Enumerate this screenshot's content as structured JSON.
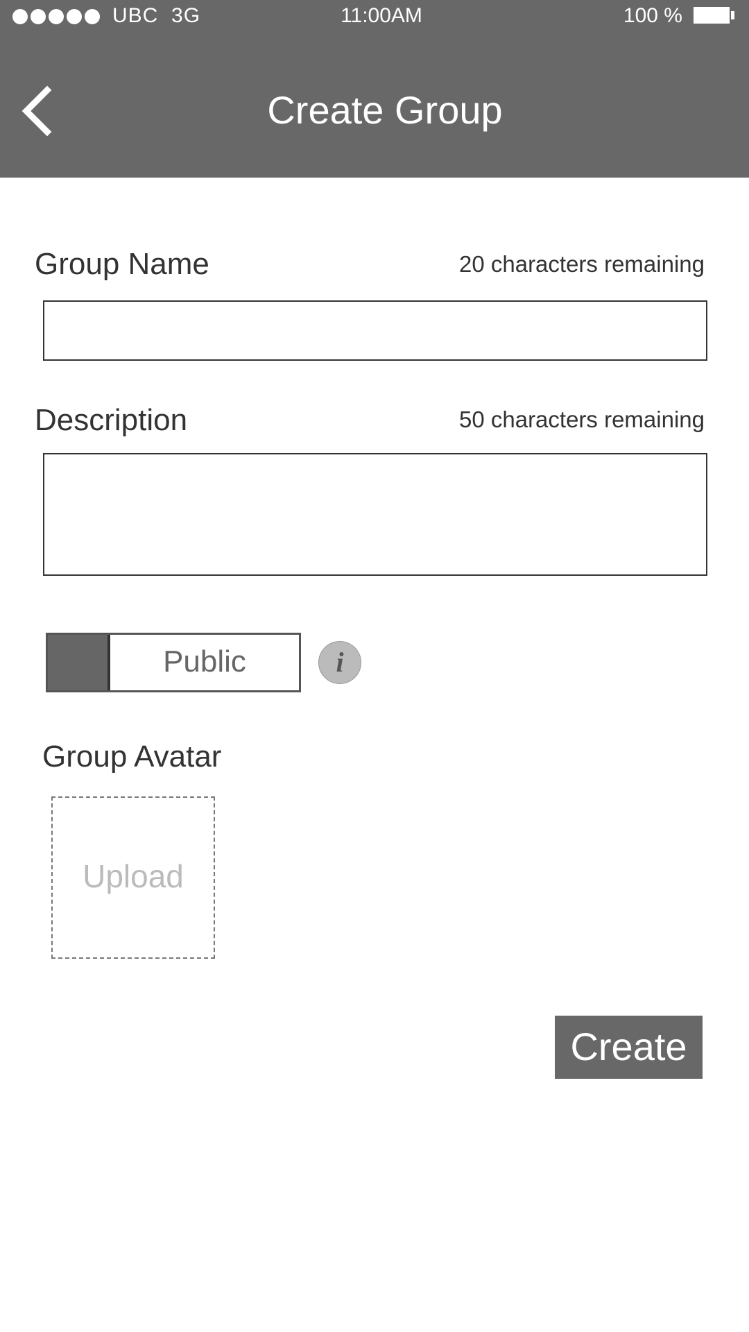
{
  "status_bar": {
    "signal_dots": 5,
    "carrier": "UBC  3G",
    "time": "11:00AM",
    "battery_percent": "100 %"
  },
  "header": {
    "title": "Create Group",
    "back_icon": "chevron-left-icon"
  },
  "form": {
    "group_name": {
      "label": "Group Name",
      "counter": "20 characters remaining",
      "value": "",
      "placeholder": ""
    },
    "description": {
      "label": "Description",
      "counter": "50 characters remaining",
      "value": "",
      "placeholder": ""
    },
    "visibility": {
      "label": "Public",
      "info_icon": "info-icon",
      "info_glyph": "i"
    },
    "avatar": {
      "label": "Group Avatar",
      "upload_label": "Upload"
    },
    "create_label": "Create"
  },
  "colors": {
    "header_bg": "#686868",
    "button_bg": "#686868",
    "text": "#333333",
    "placeholder_text": "#bbbbbb"
  }
}
